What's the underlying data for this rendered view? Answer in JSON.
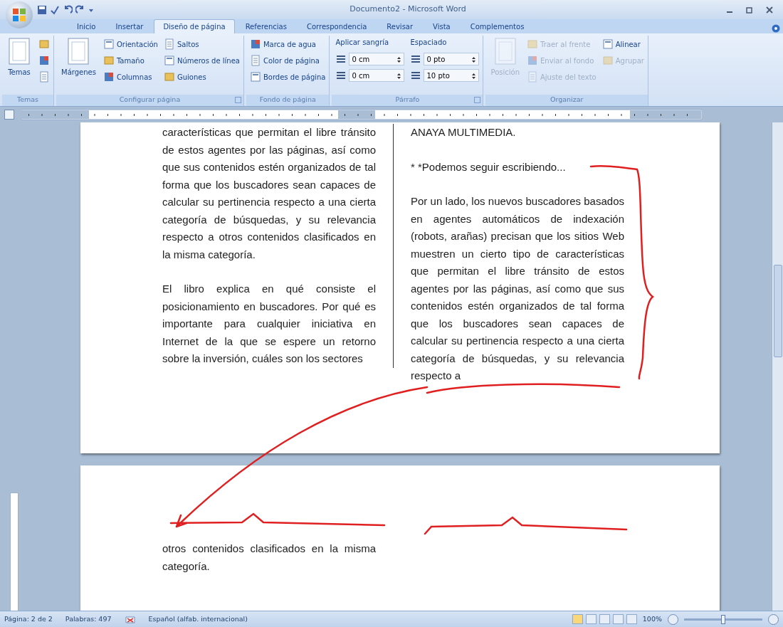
{
  "window": {
    "title": "Documento2 - Microsoft Word"
  },
  "tabs": [
    {
      "label": "Inicio",
      "selected": false
    },
    {
      "label": "Insertar",
      "selected": false
    },
    {
      "label": "Diseño de página",
      "selected": true
    },
    {
      "label": "Referencias",
      "selected": false
    },
    {
      "label": "Correspondencia",
      "selected": false
    },
    {
      "label": "Revisar",
      "selected": false
    },
    {
      "label": "Vista",
      "selected": false
    },
    {
      "label": "Complementos",
      "selected": false
    }
  ],
  "ribbon": [
    {
      "label": "Temas",
      "launcher": false,
      "columns": [
        [
          {
            "kind": "large",
            "label": "Temas",
            "disabled": false
          }
        ],
        [
          {
            "kind": "icon",
            "disabled": false
          },
          {
            "kind": "icon",
            "disabled": false
          },
          {
            "kind": "icon",
            "disabled": false
          }
        ]
      ]
    },
    {
      "label": "Configurar página",
      "launcher": true,
      "columns": [
        [
          {
            "kind": "large",
            "label": "Márgenes",
            "disabled": false
          }
        ],
        [
          {
            "kind": "small",
            "label": "Orientación",
            "disabled": false
          },
          {
            "kind": "small",
            "label": "Tamaño",
            "disabled": false
          },
          {
            "kind": "small",
            "label": "Columnas",
            "disabled": false
          }
        ],
        [
          {
            "kind": "small",
            "label": "Saltos",
            "disabled": false
          },
          {
            "kind": "small",
            "label": "Números de línea",
            "disabled": false
          },
          {
            "kind": "small",
            "label": "Guiones",
            "disabled": false
          }
        ]
      ]
    },
    {
      "label": "Fondo de página",
      "launcher": false,
      "columns": [
        [
          {
            "kind": "small",
            "label": "Marca de agua",
            "disabled": false
          },
          {
            "kind": "small",
            "label": "Color de página",
            "disabled": false
          },
          {
            "kind": "small",
            "label": "Bordes de página",
            "disabled": false
          }
        ]
      ]
    },
    {
      "label": "Párrafo",
      "launcher": true,
      "columns": [
        [
          {
            "kind": "heading",
            "label": "Aplicar sangría",
            "disabled": false
          },
          {
            "kind": "spin",
            "label": "0 cm",
            "disabled": false
          },
          {
            "kind": "spin",
            "label": "0 cm",
            "disabled": false
          }
        ],
        [
          {
            "kind": "heading",
            "label": "Espaciado",
            "disabled": false
          },
          {
            "kind": "spin",
            "label": "0 pto",
            "disabled": false
          },
          {
            "kind": "spin",
            "label": "10 pto",
            "disabled": false
          }
        ]
      ]
    },
    {
      "label": "Organizar",
      "launcher": false,
      "columns": [
        [
          {
            "kind": "large",
            "label": "Posición",
            "disabled": true
          }
        ],
        [
          {
            "kind": "small",
            "label": "Traer al frente",
            "disabled": true
          },
          {
            "kind": "small",
            "label": "Enviar al fondo",
            "disabled": true
          },
          {
            "kind": "small",
            "label": "Ajuste del texto",
            "disabled": true
          }
        ],
        [
          {
            "kind": "small",
            "label": "Alinear",
            "disabled": false
          },
          {
            "kind": "small",
            "label": "Agrupar",
            "disabled": true
          }
        ]
      ]
    }
  ],
  "pages": [
    {
      "columns": [
        [
          "características que permitan el libre tránsito de estos agentes por las páginas, así como que sus contenidos estén organizados de tal forma que los buscadores sean capaces de calcular su pertinencia respecto a una cierta categoría de búsquedas, y su relevancia respecto a otros contenidos clasificados en la misma categoría.",
          "El libro explica en qué consiste el posicionamiento en buscadores. Por qué es importante para cualquier iniciativa en Internet de la que se espere un retorno sobre la inversión, cuáles son los sectores"
        ],
        [
          "ANAYA MULTIMEDIA.",
          "* *Podemos seguir escribiendo...",
          "Por un lado, los nuevos buscadores basados en agentes automáticos de indexación (robots, arañas) precisan que los sitios Web muestren un cierto tipo de características que permitan el libre tránsito de estos agentes por las páginas, así como que sus contenidos estén organizados de tal forma que los buscadores sean capaces de calcular su pertinencia respecto a una cierta categoría de búsquedas, y su relevancia respecto a"
        ]
      ]
    },
    {
      "columns": [
        [
          "otros contenidos clasificados en la misma categoría."
        ]
      ]
    }
  ],
  "status_bar": {
    "page": "Página: 2 de 2",
    "words": "Palabras: 497",
    "language": "Español (alfab. internacional)",
    "zoom": "100%",
    "zoom_slider": {
      "level": 0.5
    }
  }
}
